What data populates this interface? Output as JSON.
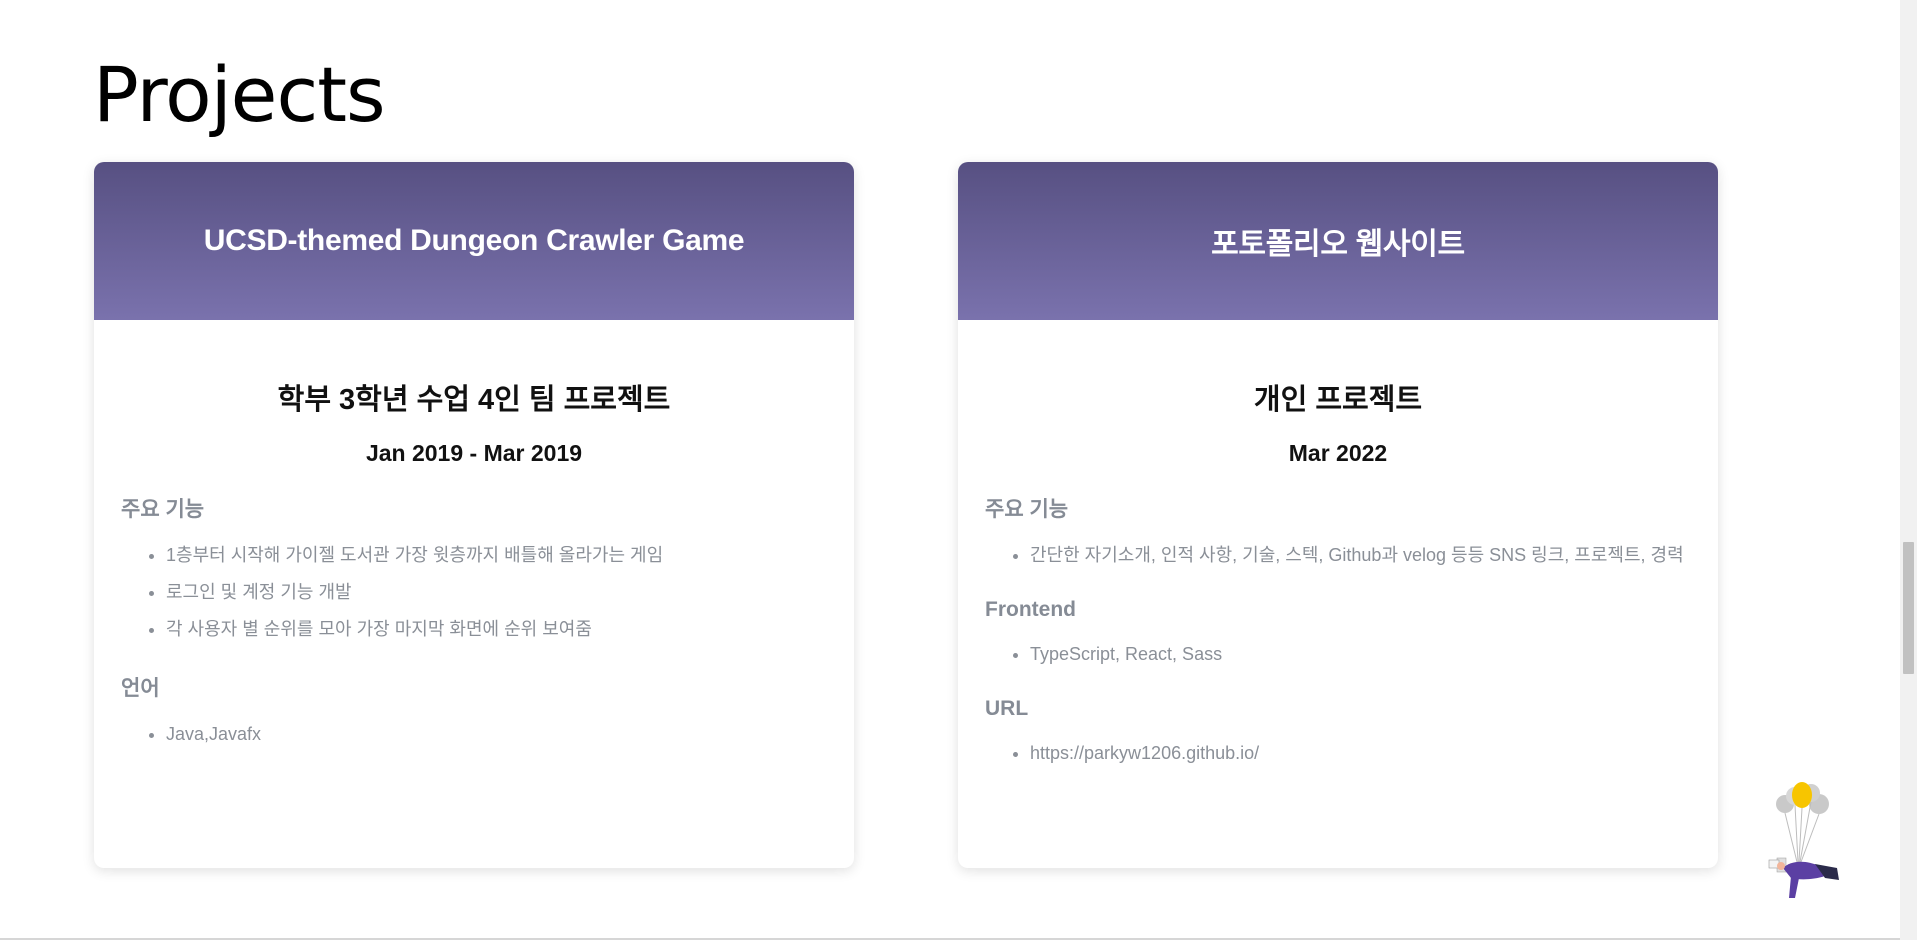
{
  "section": {
    "title": "Projects"
  },
  "projects": [
    {
      "header": "UCSD-themed Dungeon Crawler Game",
      "subtitle": "학부 3학년 수업 4인 팀 프로젝트",
      "period": "Jan 2019 - Mar 2019",
      "sections": [
        {
          "heading": "주요 기능",
          "items": [
            "1층부터 시작해 가이젤 도서관 가장 윗층까지 배틀해 올라가는 게임",
            "로그인 및 계정 기능 개발",
            "각 사용자 별 순위를 모아 가장 마지막 화면에 순위 보여줌"
          ]
        },
        {
          "heading": "언어",
          "items": [
            "Java,Javafx"
          ]
        }
      ]
    },
    {
      "header": "포토폴리오 웹사이트",
      "subtitle": "개인 프로젝트",
      "period": "Mar 2022",
      "sections": [
        {
          "heading": "주요 기능",
          "items": [
            "간단한 자기소개, 인적 사항, 기술, 스텍, Github과 velog 등등 SNS 링크, 프로젝트, 경력"
          ]
        },
        {
          "heading": "Frontend",
          "items": [
            "TypeScript, React, Sass"
          ]
        },
        {
          "heading": "URL",
          "items": [
            "https://parkyw1206.github.io/"
          ]
        }
      ]
    }
  ],
  "colors": {
    "header_gradient_top": "#575082",
    "header_gradient_bottom": "#7a72ad",
    "muted_text": "#8a8f97",
    "section_heading": "#858b95"
  },
  "icons": {
    "mascot": "balloon-person-illustration"
  }
}
